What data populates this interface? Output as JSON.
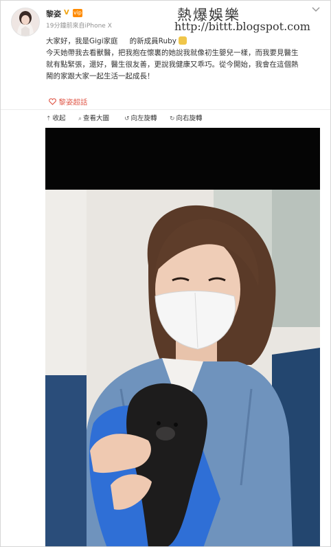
{
  "post": {
    "author": "黎姿",
    "verified_badge": "V",
    "member_badge": "vip",
    "meta": "19分鐘前來自iPhone X",
    "content_line1_a": "大家好，我是Gigi家庭",
    "content_line1_b": "的新成員Ruby",
    "content_line2": "今天她帶我去看獸醫，把我抱在懷裏的她說我就像初生嬰兒一樣，而我要見醫生",
    "content_line3": "就有點緊張，還好，醫生很友善，更說我健康又乖巧。從今開始，我會在這個熱",
    "content_line4": "鬧的家跟大家一起生活一起成長！",
    "supertopic_link": "黎姿超話"
  },
  "toolbar": {
    "collapse": "收起",
    "view_large": "查看大圖",
    "rotate_left": "向左旋轉",
    "rotate_right": "向右旋轉"
  },
  "watermark": {
    "title": "熱爆娛樂",
    "url": "http://bittt.blogspot.com"
  },
  "colors": {
    "link": "#e05a4b",
    "meta_text": "#909090",
    "badge_orange": "#ff8a00",
    "verified": "#f0a310"
  },
  "icons": [
    "chevron-down-icon",
    "supertopic-icon",
    "collapse-icon",
    "search-icon",
    "rotate-left-icon",
    "rotate-right-icon"
  ]
}
